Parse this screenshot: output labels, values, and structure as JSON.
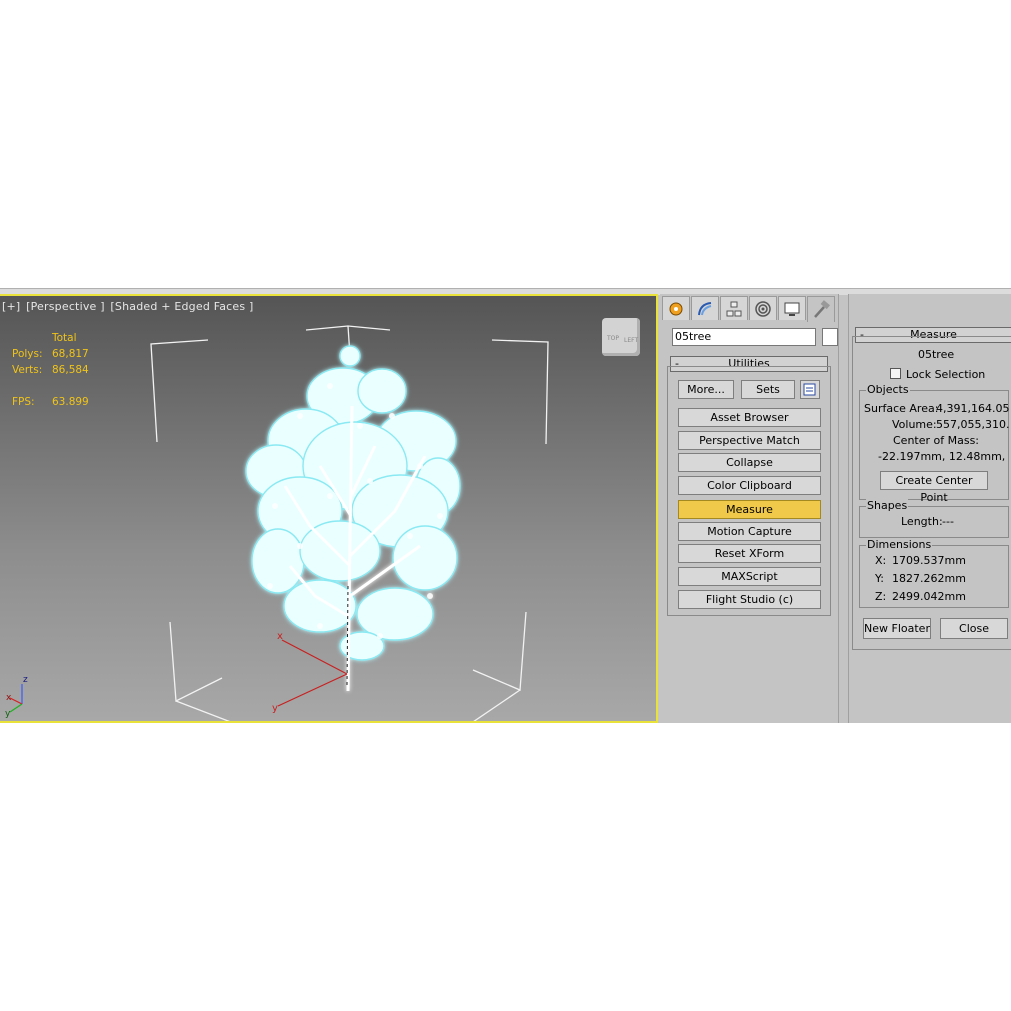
{
  "viewport": {
    "label_parts": [
      "[+]",
      "[Perspective ]",
      "[Shaded + Edged Faces ]"
    ],
    "stats": {
      "header": "Total",
      "polys_label": "Polys:",
      "polys_value": "68,817",
      "verts_label": "Verts:",
      "verts_value": "86,584",
      "fps_label": "FPS:",
      "fps_value": "63.899"
    },
    "gizmo_x": "x",
    "gizmo_y": "y",
    "axis_z": "z",
    "axis_x": "x",
    "axis_y": "y",
    "cube_faces": [
      "TOP",
      "LEFT"
    ]
  },
  "command_panel": {
    "tabs": [
      "create-icon",
      "modify-icon",
      "hierarchy-icon",
      "motion-icon",
      "display-icon",
      "utilities-icon"
    ],
    "active_tab": "utilities-icon",
    "object_name": "05tree",
    "rollout_minus": "-",
    "utilities_title": "Utilities",
    "more_label": "More...",
    "sets_label": "Sets",
    "utility_buttons": [
      "Asset Browser",
      "Perspective Match",
      "Collapse",
      "Color Clipboard",
      "Measure",
      "Motion Capture",
      "Reset XForm",
      "MAXScript",
      "Flight Studio (c)"
    ],
    "selected_utility": "Measure"
  },
  "measure": {
    "minus": "-",
    "title": "Measure",
    "object": "05tree",
    "lock_label": "Lock Selection",
    "objects_group": "Objects",
    "surface_area_label": "Surface Area:",
    "surface_area_value": "4,391,164.05",
    "volume_label": "Volume:",
    "volume_value": "557,055,310.",
    "center_mass_label": "Center of Mass:",
    "center_mass_value": "-22.197mm, 12.48mm,",
    "create_center_point": "Create Center Point",
    "shapes_group": "Shapes",
    "length_label": "Length:",
    "length_value": "---",
    "dimensions_group": "Dimensions",
    "dim_x_label": "X:",
    "dim_x_value": "1709.537mm",
    "dim_y_label": "Y:",
    "dim_y_value": "1827.262mm",
    "dim_z_label": "Z:",
    "dim_z_value": "2499.042mm",
    "new_floater": "New Floater",
    "close": "Close"
  },
  "colors": {
    "viewport_border": "#e8e23a",
    "stats_text": "#f0c419",
    "selected_button": "#f0c94a",
    "tree_wire": "#9ff0f6",
    "gizmo_red": "#c82020"
  }
}
